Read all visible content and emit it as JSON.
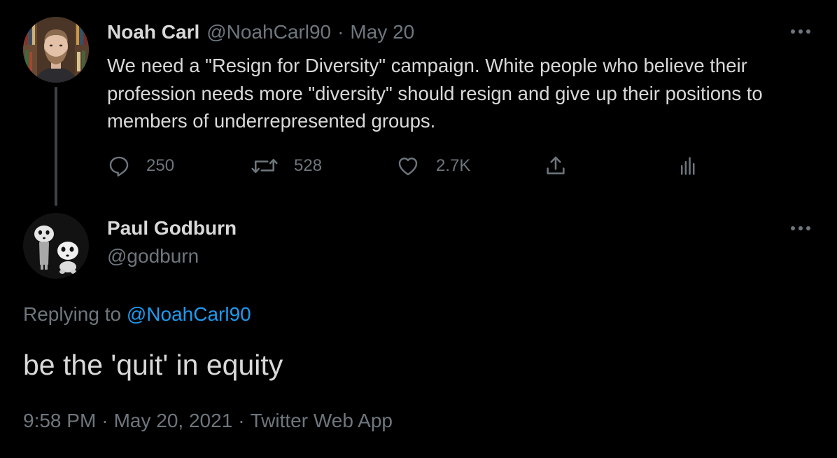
{
  "parent_tweet": {
    "author_name": "Noah Carl",
    "author_handle": "@NoahCarl90",
    "separator": "·",
    "date": "May 20",
    "text": "We need a \"Resign for Diversity\" campaign. White people who believe their profession needs more \"diversity\" should resign and give up their positions to members of underrepresented groups.",
    "actions": {
      "replies": "250",
      "retweets": "528",
      "likes": "2.7K"
    },
    "more_icon": "more-horizontal-icon"
  },
  "reply_tweet": {
    "author_name": "Paul Godburn",
    "author_handle": "@godburn",
    "replying_prefix": "Replying to ",
    "replying_handle": "@NoahCarl90",
    "text": "be the 'quit' in equity",
    "time": "9:58 PM",
    "separator": "·",
    "date": "May 20, 2021",
    "source": "Twitter Web App",
    "more_icon": "more-horizontal-icon"
  },
  "colors": {
    "background": "#000000",
    "primary_text": "#d9d9d9",
    "secondary_text": "#6e767d",
    "link": "#1d9bf0",
    "thread_line": "#3d4247"
  }
}
